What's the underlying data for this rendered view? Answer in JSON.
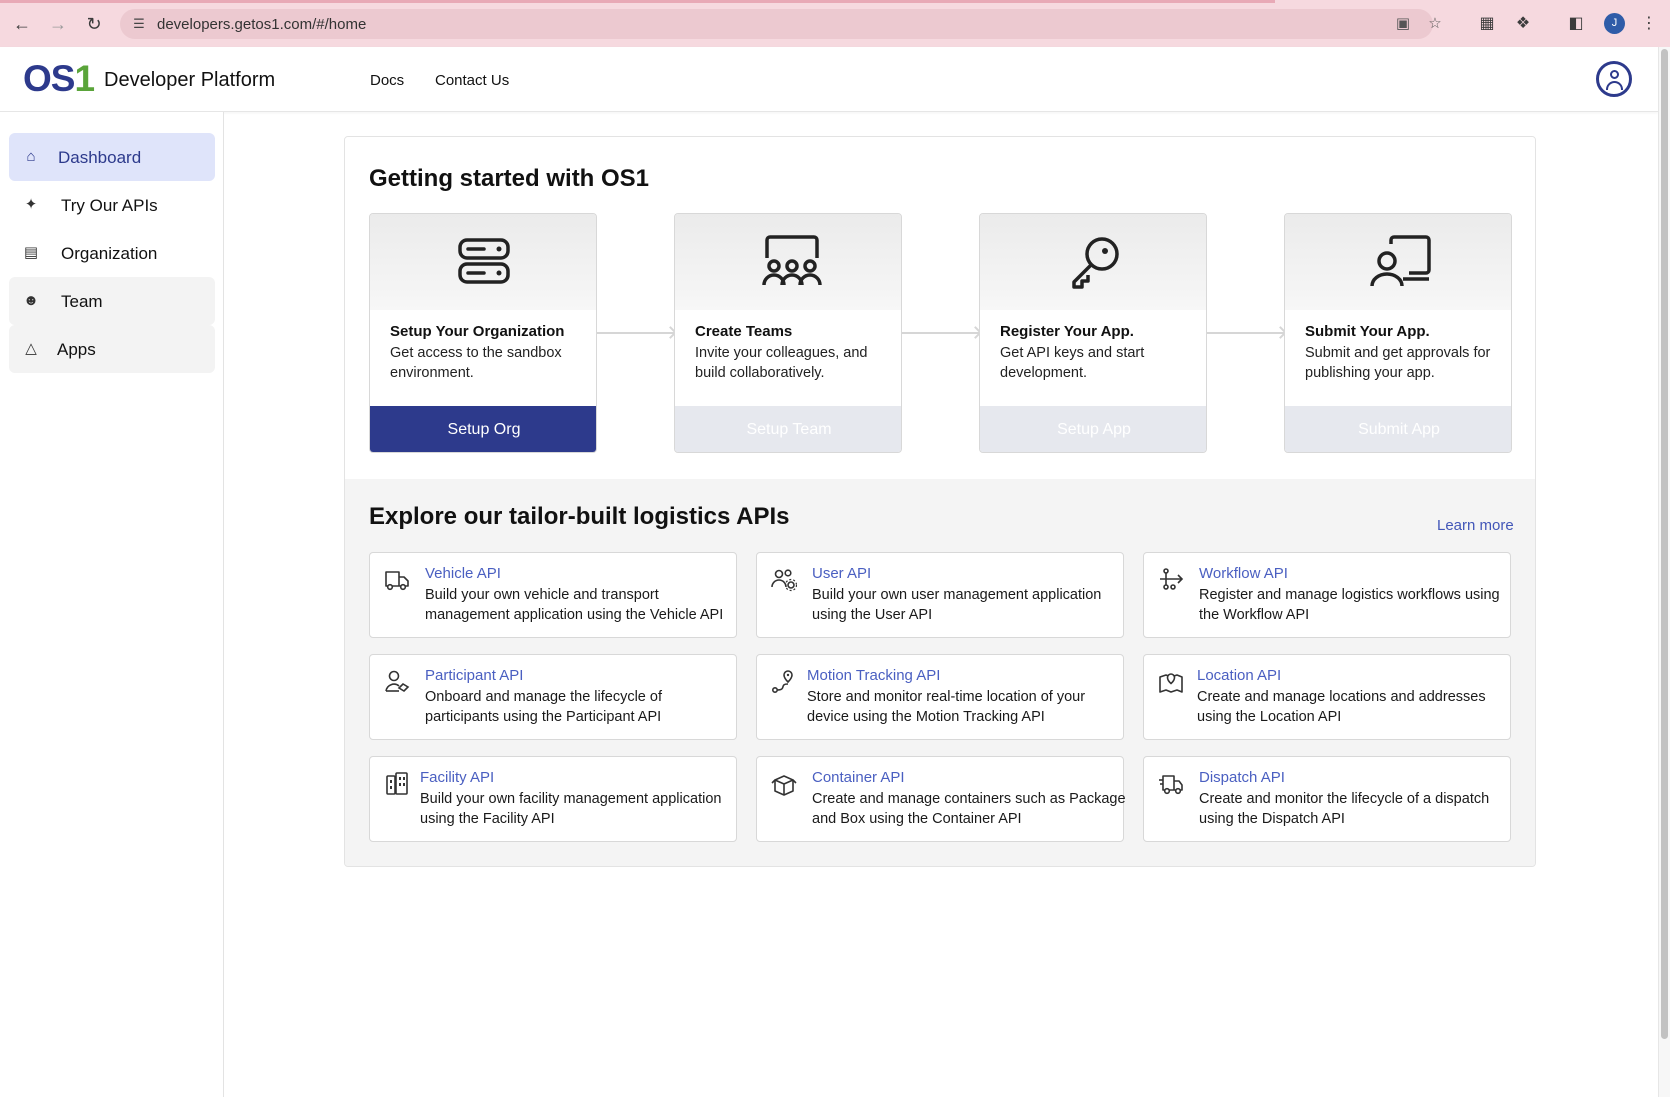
{
  "browser": {
    "url": "developers.getos1.com/#/home",
    "profile_initial": "J"
  },
  "header": {
    "logo_os": "OS",
    "logo_one": "1",
    "brand": "Developer Platform",
    "nav": [
      "Docs",
      "Contact Us"
    ]
  },
  "sidebar": {
    "items": [
      {
        "label": "Dashboard",
        "icon": "home-icon"
      },
      {
        "label": "Try Our APIs",
        "icon": "network-icon"
      },
      {
        "label": "Organization",
        "icon": "org-chart-icon"
      },
      {
        "label": "Team",
        "icon": "team-icon"
      },
      {
        "label": "Apps",
        "icon": "apps-icon"
      }
    ]
  },
  "getting_started": {
    "title": "Getting started with OS1",
    "steps": [
      {
        "title": "Setup Your Organization",
        "desc": "Get access to the sandbox environment.",
        "button": "Setup Org",
        "icon": "server-icon"
      },
      {
        "title": "Create Teams",
        "desc": "Invite your colleagues, and build collaboratively.",
        "button": "Setup Team",
        "icon": "presentation-team-icon"
      },
      {
        "title": "Register Your App.",
        "desc": "Get API keys and start development.",
        "button": "Setup App",
        "icon": "key-icon"
      },
      {
        "title": "Submit Your App.",
        "desc": "Submit and get approvals for publishing your app.",
        "button": "Submit App",
        "icon": "user-laptop-icon"
      }
    ]
  },
  "explore": {
    "title": "Explore our tailor-built logistics APIs",
    "learn_more": "Learn more",
    "apis": [
      {
        "name": "Vehicle API",
        "line1": "Build your own vehicle and transport",
        "line2": "management application using the Vehicle API",
        "icon": "truck-icon"
      },
      {
        "name": "User API",
        "line1": "Build your own user management application",
        "line2": "using the User API",
        "icon": "users-gear-icon"
      },
      {
        "name": "Workflow API",
        "line1": "Register and manage logistics workflows using",
        "line2": "the Workflow API",
        "icon": "workflow-icon"
      },
      {
        "name": "Participant API",
        "line1": "Onboard and manage the lifecycle of",
        "line2": "participants using the Participant API",
        "icon": "participant-icon"
      },
      {
        "name": "Motion Tracking API",
        "line1": "Store and monitor real-time location of your",
        "line2": "device using the Motion Tracking API",
        "icon": "route-pin-icon"
      },
      {
        "name": "Location API",
        "line1": "Create and manage locations and addresses",
        "line2": "using the Location API",
        "icon": "map-pin-icon"
      },
      {
        "name": "Facility API",
        "line1": "Build your own facility management application",
        "line2": "using the Facility API",
        "icon": "building-icon"
      },
      {
        "name": "Container API",
        "line1": "Create and manage containers such as Package",
        "line2": "and Box using the Container API",
        "icon": "box-icon"
      },
      {
        "name": "Dispatch API",
        "line1": "Create and monitor the lifecycle of a dispatch",
        "line2": "using the Dispatch API",
        "icon": "dispatch-truck-icon"
      }
    ]
  }
}
